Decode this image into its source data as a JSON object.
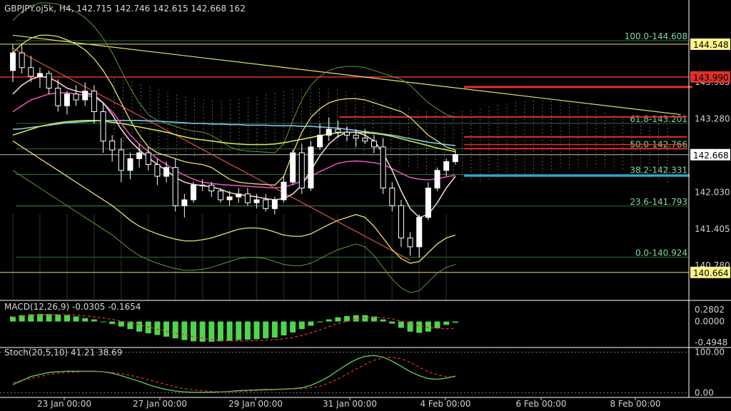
{
  "header": {
    "symbol_line": "GBPJPY.oj5k, H4, 142.715 142.746 142.615 142.668 162"
  },
  "macd_header": "MACD(12,26,9) -0.0305 -0.1654",
  "stoch_header": "Stoch(20,5,10) 41.21 38.69",
  "price_axis": {
    "range": [
      140.2,
      145.3
    ],
    "ticks": [
      "143.905",
      "143.280",
      "142.030",
      "141.405",
      "140.780"
    ],
    "highlighted": [
      {
        "label": "144.548",
        "value": 144.548,
        "bg": "#fff38a",
        "fg": "#000000"
      },
      {
        "label": "143.990",
        "value": 143.99,
        "bg": "#e0302a",
        "fg": "#000000"
      },
      {
        "label": "142.668",
        "value": 142.668,
        "bg": "#ffffff",
        "fg": "#000000"
      },
      {
        "label": "140.664",
        "value": 140.664,
        "bg": "#fff38a",
        "fg": "#000000"
      }
    ]
  },
  "fibonacci": [
    {
      "label": "100.0-144.608",
      "value": 144.608
    },
    {
      "label": "61.8-143.201",
      "value": 143.201
    },
    {
      "label": "50.0-142.766",
      "value": 142.766
    },
    {
      "label": "38.2-142.331",
      "value": 142.331
    },
    {
      "label": "23.6-141.793",
      "value": 141.793
    },
    {
      "label": "0.0-140.924",
      "value": 140.924
    }
  ],
  "macd_axis": {
    "range": [
      -0.6,
      0.45
    ],
    "ticks": [
      "0.2802",
      "0.0000",
      "-0.4948"
    ]
  },
  "stoch_axis": {
    "range": [
      -10,
      110
    ],
    "ticks": [
      "100.00",
      "0.00"
    ]
  },
  "time_axis": {
    "labels": [
      "23 Jan 00:00",
      "27 Jan 00:00",
      "29 Jan 00:00",
      "31 Jan 00:00",
      "4 Feb 00:00",
      "6 Feb 00:00",
      "8 Feb 00:00"
    ]
  },
  "colors": {
    "background": "#000000",
    "bull": "#ffffff",
    "bear": "#ffffff",
    "resistance": "#e0302a",
    "support": "#27a8e0",
    "trend_yellow": "#e8e070",
    "trend_red": "#e05050",
    "macd_hist": "#4cd84c",
    "signal": "#e03030",
    "stoch_main": "#5ac85a"
  },
  "chart_data": {
    "type": "candlestick",
    "title": "GBPJPY.oj5k, H4",
    "last_price": 142.668,
    "ohlc": [
      [
        144.1,
        144.55,
        143.9,
        144.4
      ],
      [
        144.4,
        144.55,
        144.05,
        144.15
      ],
      [
        144.15,
        144.35,
        143.9,
        144.0
      ],
      [
        144.0,
        144.15,
        143.8,
        144.05
      ],
      [
        144.05,
        144.1,
        143.7,
        143.8
      ],
      [
        143.8,
        143.95,
        143.4,
        143.5
      ],
      [
        143.5,
        143.75,
        143.35,
        143.7
      ],
      [
        143.7,
        143.85,
        143.5,
        143.6
      ],
      [
        143.6,
        143.9,
        143.5,
        143.75
      ],
      [
        143.75,
        143.85,
        143.2,
        143.4
      ],
      [
        143.4,
        143.55,
        142.7,
        142.9
      ],
      [
        142.9,
        143.0,
        142.55,
        142.75
      ],
      [
        142.75,
        142.95,
        142.2,
        142.4
      ],
      [
        142.4,
        142.7,
        142.25,
        142.6
      ],
      [
        142.6,
        142.85,
        142.45,
        142.7
      ],
      [
        142.7,
        142.8,
        142.4,
        142.5
      ],
      [
        142.5,
        142.6,
        142.15,
        142.3
      ],
      [
        142.3,
        142.55,
        142.2,
        142.45
      ],
      [
        142.45,
        142.6,
        141.7,
        141.8
      ],
      [
        141.8,
        142.0,
        141.6,
        141.9
      ],
      [
        141.9,
        142.2,
        141.85,
        142.15
      ],
      [
        142.15,
        142.25,
        142.05,
        142.15
      ],
      [
        142.15,
        142.2,
        141.95,
        142.05
      ],
      [
        142.05,
        142.1,
        141.85,
        141.9
      ],
      [
        141.9,
        142.05,
        141.8,
        141.95
      ],
      [
        141.95,
        142.1,
        141.85,
        142.0
      ],
      [
        142.0,
        142.1,
        141.8,
        141.85
      ],
      [
        141.85,
        142.0,
        141.75,
        141.9
      ],
      [
        141.9,
        142.0,
        141.7,
        141.75
      ],
      [
        141.75,
        141.95,
        141.65,
        141.9
      ],
      [
        141.9,
        142.3,
        141.85,
        142.2
      ],
      [
        142.2,
        142.75,
        142.15,
        142.7
      ],
      [
        142.7,
        142.85,
        142.0,
        142.1
      ],
      [
        142.1,
        142.9,
        142.05,
        142.8
      ],
      [
        142.8,
        143.2,
        142.75,
        143.0
      ],
      [
        143.0,
        143.3,
        142.9,
        143.1
      ],
      [
        143.1,
        143.25,
        142.95,
        143.05
      ],
      [
        143.05,
        143.15,
        142.9,
        143.0
      ],
      [
        143.0,
        143.1,
        142.8,
        142.95
      ],
      [
        142.95,
        143.1,
        142.85,
        142.9
      ],
      [
        142.9,
        143.0,
        142.7,
        142.8
      ],
      [
        142.8,
        142.95,
        142.0,
        142.1
      ],
      [
        142.1,
        142.2,
        141.7,
        141.8
      ],
      [
        141.8,
        141.9,
        141.1,
        141.25
      ],
      [
        141.25,
        141.35,
        140.95,
        141.1
      ],
      [
        141.1,
        141.65,
        140.92,
        141.6
      ],
      [
        141.6,
        142.2,
        141.55,
        142.1
      ],
      [
        142.1,
        142.45,
        142.05,
        142.4
      ],
      [
        142.4,
        142.6,
        142.3,
        142.55
      ],
      [
        142.55,
        142.75,
        142.5,
        142.67
      ]
    ],
    "moving_averages": [
      {
        "color": "#7ec8e8",
        "values": [
          143.1,
          143.11,
          143.13,
          143.15,
          143.17,
          143.19,
          143.21,
          143.22,
          143.23,
          143.24,
          143.25,
          143.25,
          143.25,
          143.25,
          143.25,
          143.24,
          143.24,
          143.23,
          143.22,
          143.21,
          143.2,
          143.2,
          143.19,
          143.19,
          143.18,
          143.18,
          143.17,
          143.17,
          143.17,
          143.16,
          143.16,
          143.16,
          143.15,
          143.15,
          143.14,
          143.13,
          143.12,
          143.1,
          143.08,
          143.06,
          143.04,
          143.02,
          143.0,
          142.97,
          142.94,
          142.91,
          142.88,
          142.86,
          142.84,
          142.82
        ]
      },
      {
        "color": "#c8e850",
        "values": [
          143.0,
          143.05,
          143.1,
          143.15,
          143.18,
          143.21,
          143.23,
          143.24,
          143.25,
          143.25,
          143.24,
          143.22,
          143.2,
          143.17,
          143.14,
          143.11,
          143.08,
          143.05,
          143.01,
          142.97,
          142.94,
          142.92,
          142.9,
          142.88,
          142.86,
          142.85,
          142.84,
          142.84,
          142.84,
          142.85,
          142.87,
          142.9,
          142.93,
          142.96,
          142.99,
          143.02,
          143.04,
          143.05,
          143.05,
          143.04,
          143.03,
          143.01,
          142.98,
          142.94,
          142.9,
          142.86,
          142.82,
          142.78,
          142.75,
          142.72
        ]
      },
      {
        "color": "#e050b8",
        "values": [
          143.4,
          143.5,
          143.6,
          143.65,
          143.7,
          143.72,
          143.72,
          143.7,
          143.68,
          143.65,
          143.55,
          143.4,
          143.2,
          143.0,
          142.85,
          142.72,
          142.6,
          142.5,
          142.4,
          142.32,
          142.25,
          142.2,
          142.18,
          142.16,
          142.15,
          142.14,
          142.13,
          142.12,
          142.11,
          142.1,
          142.12,
          142.16,
          142.22,
          142.3,
          142.38,
          142.45,
          142.52,
          142.55,
          142.56,
          142.55,
          142.53,
          142.5,
          142.43,
          142.35,
          142.28,
          142.25,
          142.24,
          142.26,
          142.29,
          142.32
        ]
      },
      {
        "color": "#f0d0d0",
        "values": [
          143.7,
          143.85,
          143.95,
          144.0,
          143.98,
          143.9,
          143.8,
          143.75,
          143.72,
          143.68,
          143.55,
          143.35,
          143.1,
          142.9,
          142.75,
          142.62,
          142.5,
          142.4,
          142.28,
          142.2,
          142.16,
          142.14,
          142.12,
          142.08,
          142.02,
          141.99,
          141.97,
          141.95,
          141.92,
          141.9,
          141.92,
          142.0,
          142.15,
          142.4,
          142.65,
          142.85,
          142.98,
          143.05,
          143.05,
          143.0,
          142.9,
          142.7,
          142.4,
          142.05,
          141.75,
          141.6,
          141.65,
          141.85,
          142.1,
          142.3
        ]
      }
    ],
    "bollinger": {
      "color": "#e8e070",
      "upper": [
        144.4,
        144.55,
        144.65,
        144.7,
        144.7,
        144.68,
        144.62,
        144.55,
        144.45,
        144.3,
        144.1,
        143.85,
        143.55,
        143.25,
        143.0,
        142.8,
        142.7,
        142.65,
        142.6,
        142.55,
        142.52,
        142.5,
        142.45,
        142.35,
        142.25,
        142.2,
        142.18,
        142.17,
        142.16,
        142.15,
        142.3,
        142.7,
        143.05,
        143.3,
        143.45,
        143.55,
        143.6,
        143.62,
        143.62,
        143.6,
        143.55,
        143.5,
        143.45,
        143.4,
        143.3,
        143.15,
        143.0,
        142.9,
        142.8,
        142.75
      ],
      "lower": [
        142.9,
        142.8,
        142.7,
        142.6,
        142.5,
        142.4,
        142.3,
        142.2,
        142.1,
        142.0,
        141.9,
        141.8,
        141.68,
        141.55,
        141.45,
        141.38,
        141.32,
        141.27,
        141.23,
        141.2,
        141.2,
        141.22,
        141.25,
        141.3,
        141.35,
        141.4,
        141.42,
        141.42,
        141.4,
        141.35,
        141.3,
        141.28,
        141.28,
        141.32,
        141.4,
        141.48,
        141.55,
        141.6,
        141.65,
        141.6,
        141.45,
        141.25,
        141.05,
        140.9,
        140.82,
        140.85,
        141.0,
        141.15,
        141.25,
        141.3
      ]
    },
    "trendlines": [
      {
        "color": "#e8e070",
        "x": [
          0,
          55
        ],
        "y": [
          144.7,
          143.8
        ]
      },
      {
        "color": "#e05050",
        "x": [
          0,
          44
        ],
        "y": [
          144.48,
          140.87
        ]
      }
    ],
    "macd": {
      "range": [
        -0.6,
        0.45
      ],
      "histogram": [
        0.12,
        0.15,
        0.17,
        0.18,
        0.18,
        0.17,
        0.15,
        0.12,
        0.08,
        0.05,
        0.0,
        -0.06,
        -0.12,
        -0.18,
        -0.24,
        -0.28,
        -0.32,
        -0.36,
        -0.4,
        -0.44,
        -0.47,
        -0.48,
        -0.48,
        -0.47,
        -0.46,
        -0.44,
        -0.43,
        -0.42,
        -0.4,
        -0.38,
        -0.33,
        -0.26,
        -0.18,
        -0.1,
        -0.02,
        0.05,
        0.1,
        0.13,
        0.15,
        0.15,
        0.12,
        0.05,
        -0.05,
        -0.15,
        -0.24,
        -0.27,
        -0.24,
        -0.16,
        -0.08,
        -0.03
      ],
      "signal": [
        0.1,
        0.12,
        0.14,
        0.15,
        0.16,
        0.16,
        0.16,
        0.15,
        0.13,
        0.11,
        0.08,
        0.05,
        0.01,
        -0.03,
        -0.08,
        -0.13,
        -0.18,
        -0.23,
        -0.28,
        -0.32,
        -0.36,
        -0.4,
        -0.43,
        -0.45,
        -0.46,
        -0.46,
        -0.46,
        -0.45,
        -0.44,
        -0.43,
        -0.41,
        -0.38,
        -0.33,
        -0.27,
        -0.2,
        -0.12,
        -0.05,
        0.01,
        0.06,
        0.09,
        0.1,
        0.09,
        0.06,
        0.01,
        -0.05,
        -0.1,
        -0.14,
        -0.16,
        -0.17,
        -0.165
      ]
    },
    "stochastic": {
      "range": [
        -10,
        110
      ],
      "main": [
        20,
        30,
        40,
        45,
        50,
        52,
        53,
        53,
        53,
        53,
        52,
        48,
        42,
        35,
        28,
        20,
        13,
        8,
        4,
        2,
        1,
        1,
        1,
        2,
        3,
        5,
        6,
        7,
        8,
        8,
        9,
        10,
        12,
        18,
        28,
        40,
        55,
        70,
        82,
        90,
        92,
        88,
        78,
        65,
        52,
        42,
        35,
        33,
        36,
        41
      ],
      "signal": [
        25,
        30,
        35,
        40,
        45,
        48,
        50,
        51,
        52,
        52,
        52,
        50,
        47,
        43,
        38,
        32,
        26,
        20,
        14,
        10,
        7,
        5,
        3,
        2,
        2,
        3,
        4,
        5,
        6,
        7,
        8,
        9,
        10,
        12,
        16,
        24,
        34,
        46,
        58,
        70,
        80,
        86,
        88,
        84,
        75,
        63,
        52,
        44,
        40,
        39
      ]
    }
  }
}
